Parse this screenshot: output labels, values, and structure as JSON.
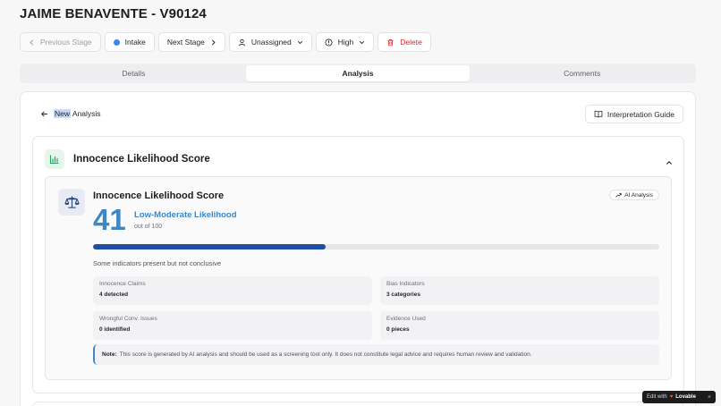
{
  "header": {
    "title": "JAIME BENAVENTE - V90124"
  },
  "toolbar": {
    "previous_stage": "Previous Stage",
    "current_stage": "Intake",
    "next_stage": "Next Stage",
    "assignee": "Unassigned",
    "priority": "High",
    "delete": "Delete",
    "colors": {
      "stage_dot": "#3b82f6",
      "delete": "#dc2626"
    }
  },
  "tabs": [
    {
      "label": "Details",
      "active": false
    },
    {
      "label": "Analysis",
      "active": true
    },
    {
      "label": "Comments",
      "active": false
    }
  ],
  "analysis": {
    "back_new": "New",
    "back_rest": " Analysis",
    "guide_button": "Interpretation Guide",
    "section_title": "Innocence Likelihood Score",
    "score_card": {
      "title": "Innocence Likelihood Score",
      "badge": "AI Analysis",
      "score": "41",
      "likelihood": "Low-Moderate Likelihood",
      "out_of": "out of 100",
      "progress_fraction": 0.41,
      "summary": "Some indicators present but not conclusive",
      "stats": [
        {
          "label": "Innocence Claims",
          "value": "4 detected"
        },
        {
          "label": "Bias Indicators",
          "value": "3 categories"
        },
        {
          "label": "Wrongful Conv. Issues",
          "value": "0 identified"
        },
        {
          "label": "Evidence Used",
          "value": "0 pieces"
        }
      ],
      "note_label": "Note:",
      "note_text": "This score is generated by AI analysis and should be used as a screening tool only. It does not constitute legal advice and requires human review and validation.",
      "colors": {
        "score": "#3d87c5",
        "bar_fill": "#1f4fa0",
        "bar_track": "#e6e6e9"
      }
    }
  },
  "badge_overlay": {
    "prefix": "Edit with",
    "brand": "Lovable",
    "close": "×"
  }
}
